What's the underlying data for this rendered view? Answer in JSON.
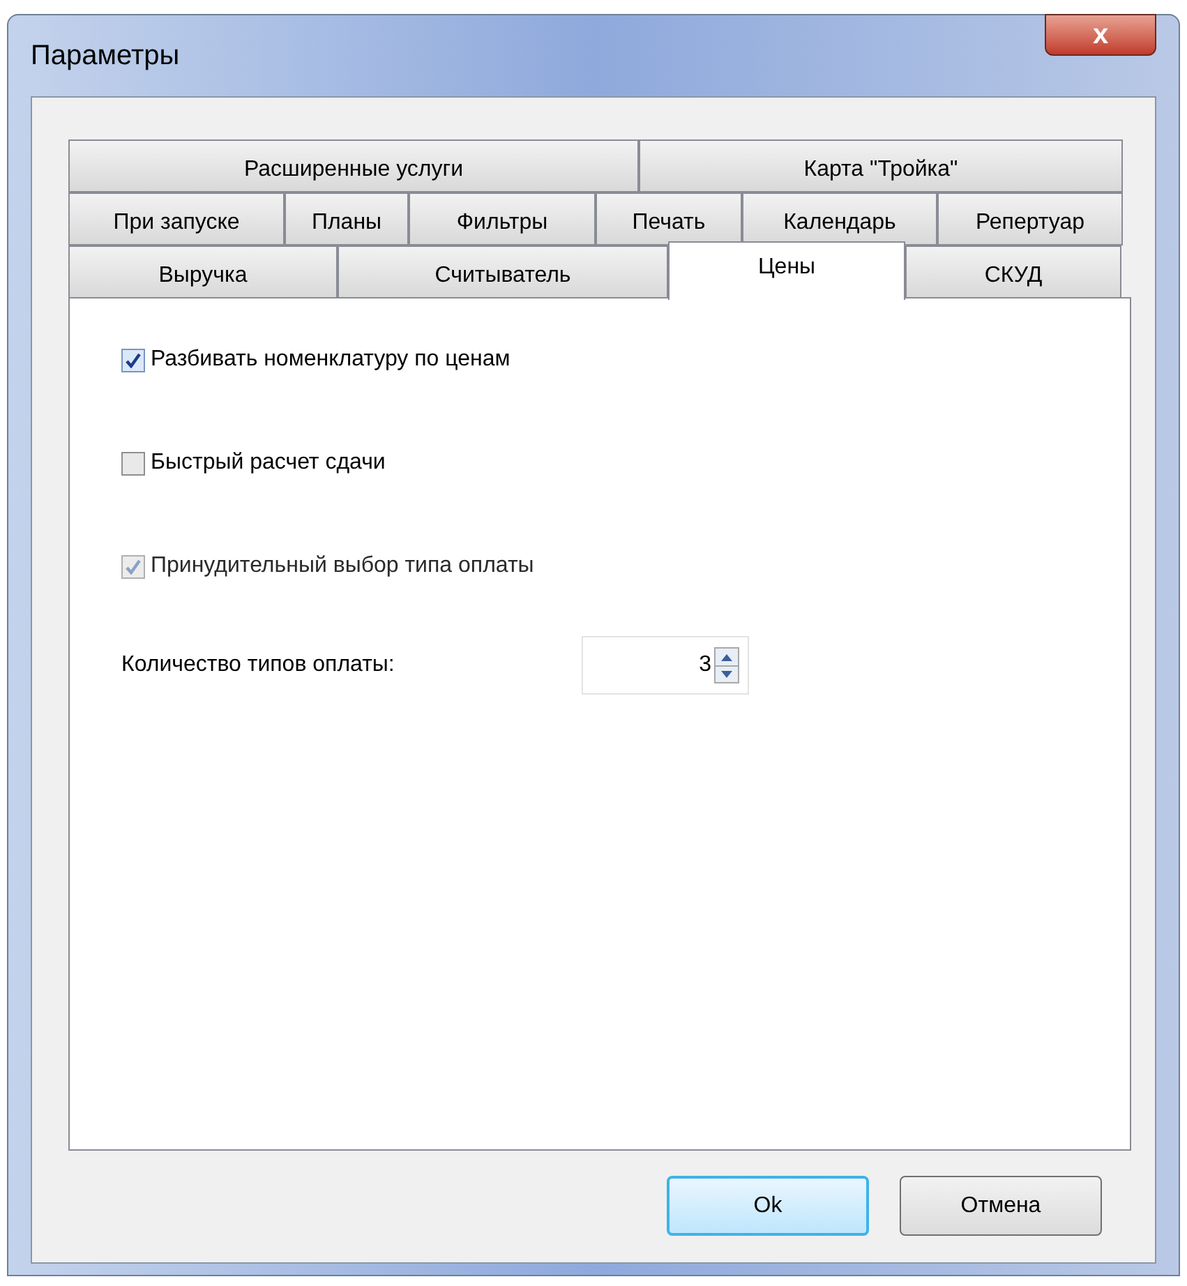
{
  "window": {
    "title": "Параметры",
    "close_label": "x"
  },
  "tab_rows": [
    [
      {
        "label": "Расширенные услуги",
        "selected": false
      },
      {
        "label": "Карта \"Тройка\"",
        "selected": false
      }
    ],
    [
      {
        "label": "При запуске",
        "selected": false
      },
      {
        "label": "Планы",
        "selected": false
      },
      {
        "label": "Фильтры",
        "selected": false
      },
      {
        "label": "Печать",
        "selected": false
      },
      {
        "label": "Календарь",
        "selected": false
      },
      {
        "label": "Репертуар",
        "selected": false
      }
    ],
    [
      {
        "label": "Выручка",
        "selected": false
      },
      {
        "label": "Считыватель",
        "selected": false
      },
      {
        "label": "Цены",
        "selected": true
      },
      {
        "label": "СКУД",
        "selected": false
      }
    ]
  ],
  "options": [
    {
      "label": "Разбивать номенклатуру по ценам",
      "checked": true,
      "disabled": false
    },
    {
      "label": "Быстрый расчет сдачи",
      "checked": false,
      "disabled": false
    },
    {
      "label": "Принудительный выбор типа оплаты",
      "checked": true,
      "disabled": true
    }
  ],
  "payment_types": {
    "label": "Количество типов оплаты:",
    "value": "3"
  },
  "buttons": [
    {
      "label": "Ok",
      "default": true
    },
    {
      "label": "Отмена",
      "default": false
    }
  ]
}
